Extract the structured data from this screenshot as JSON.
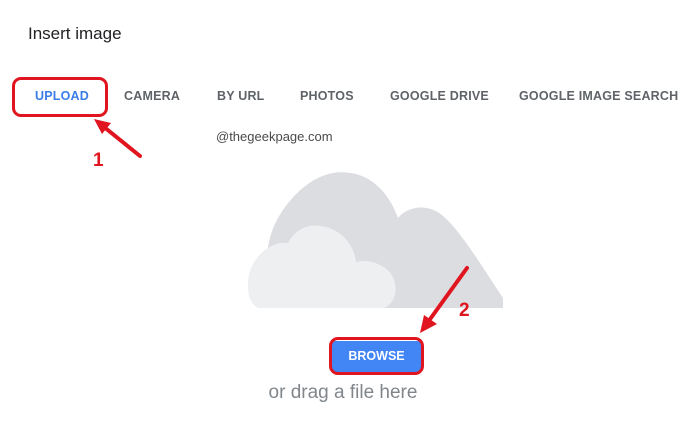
{
  "dialog": {
    "title": "Insert image"
  },
  "tabs": [
    {
      "label": "UPLOAD",
      "active": true
    },
    {
      "label": "CAMERA",
      "active": false
    },
    {
      "label": "BY URL",
      "active": false
    },
    {
      "label": "PHOTOS",
      "active": false
    },
    {
      "label": "GOOGLE DRIVE",
      "active": false
    },
    {
      "label": "GOOGLE IMAGE SEARCH",
      "active": false
    }
  ],
  "watermark": "@thegeekpage.com",
  "upload": {
    "browse_label": "BROWSE",
    "drag_text": "or drag a file here",
    "illustration": "cloud-icon"
  },
  "annotations": {
    "step1": "1",
    "step2": "2",
    "color": "#e0151f"
  },
  "colors": {
    "accent": "#4285f4",
    "active_tab": "#3b7de6",
    "annotation": "#e0151f"
  }
}
